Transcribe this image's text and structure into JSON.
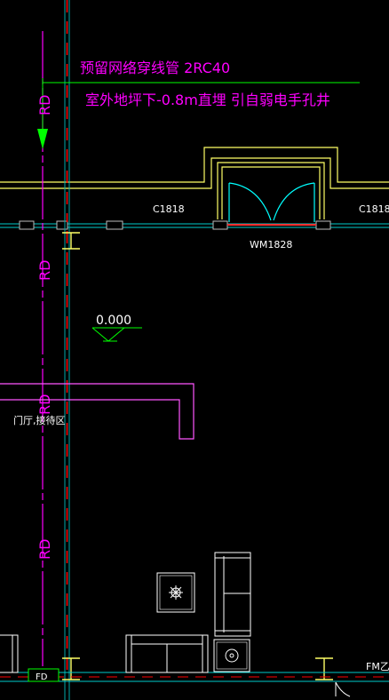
{
  "annotations": {
    "line1": "预留网络穿线管 2RC40",
    "line2": "室外地坪下-0.8m直埋 引自弱电手孔井"
  },
  "rd_labels": [
    "RD",
    "RD",
    "RD",
    "RD"
  ],
  "windows": {
    "left": "C1818",
    "right": "C1818"
  },
  "door_label": "WM1828",
  "elevation": "0.000",
  "room_label": "门厅,接待区",
  "fd_label": "FD",
  "fm_label": "FM乙",
  "colors": {
    "background": "#000000",
    "magenta": "#ff00ff",
    "green": "#00ff00",
    "yellow": "#ffff00",
    "cyan": "#00ffff",
    "red": "#ff0000",
    "white": "#ffffff",
    "wall": "#7f7f7f"
  }
}
